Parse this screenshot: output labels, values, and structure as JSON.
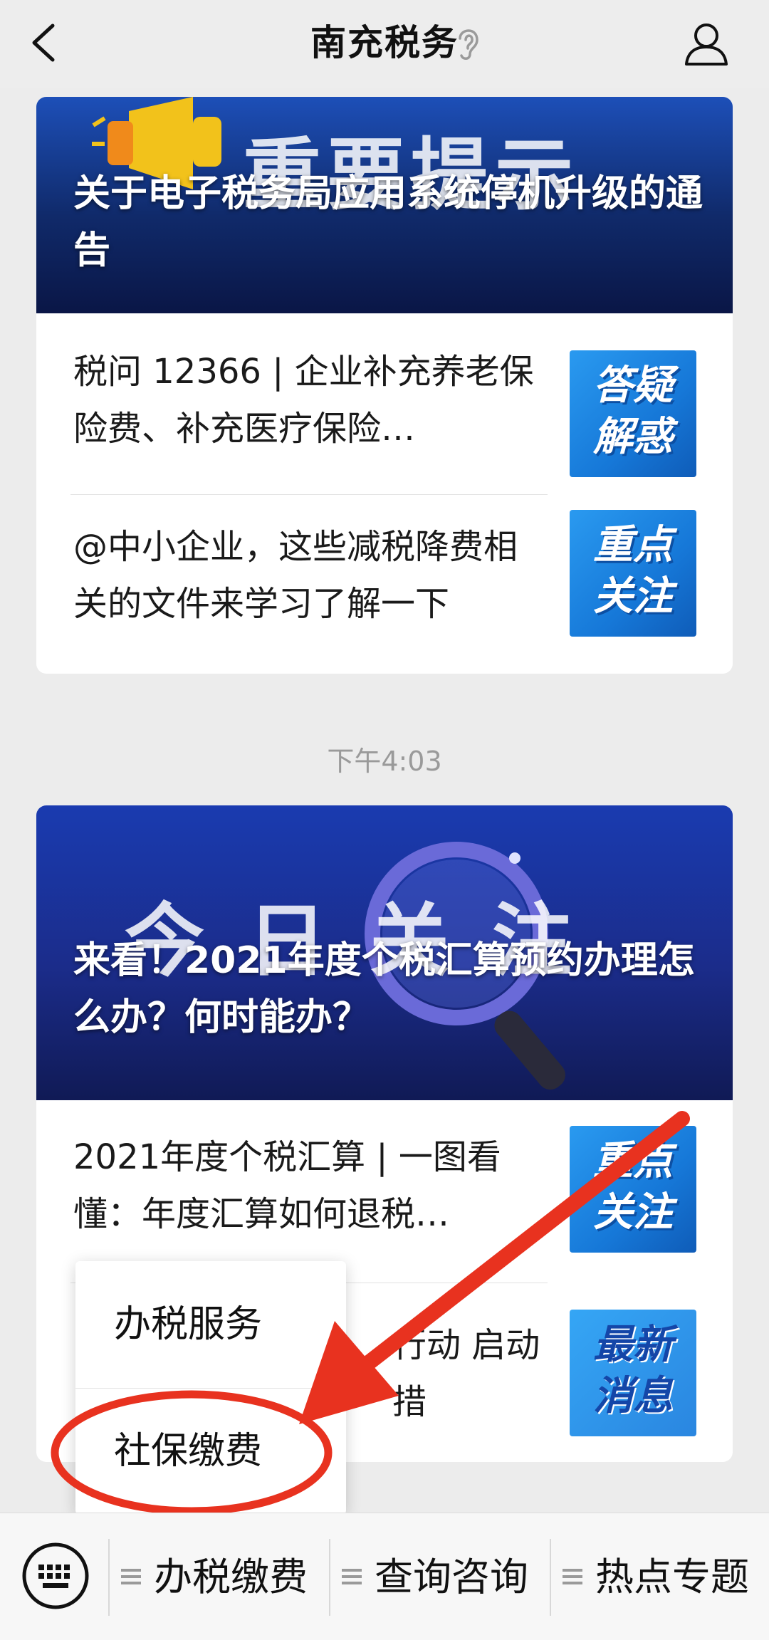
{
  "header": {
    "title": "南充税务"
  },
  "articles": [
    {
      "banner_art": "重要提示",
      "banner_title": "关于电子税务局应用系统停机升级的通告",
      "items": [
        {
          "text": "税问 12366 | 企业补充养老保险费、补充医疗保险…",
          "thumb_label": "答疑解惑"
        },
        {
          "text": "@中小企业，这些减税降费相关的文件来学习了解一下",
          "thumb_label": "重点关注"
        }
      ]
    },
    {
      "banner_art": "今日关注",
      "banner_title": "来看！2021年度个税汇算预约办理怎么办？何时能办？",
      "items": [
        {
          "text": "2021年度个税汇算 | 一图看懂：年度汇算如何退税…",
          "thumb_label": "重点关注"
        },
        {
          "text_fragment_1": "行动 启动",
          "text_fragment_2": "措",
          "thumb_label": "最新消息"
        }
      ]
    }
  ],
  "timestamp": "下午4:03",
  "popup_menu": {
    "items": [
      "办税服务",
      "社保缴费"
    ],
    "highlighted_index": 1
  },
  "bottom_menu": {
    "tabs": [
      "办税缴费",
      "查询咨询",
      "热点专题"
    ]
  },
  "colors": {
    "annotation": "#e8321f",
    "banner_blue": "#1d4fb8",
    "thumb_blue": "#1678d8"
  },
  "icons": [
    "back-arrow-icon",
    "ear-icon",
    "profile-icon",
    "keyboard-icon",
    "menu-lines-icon"
  ]
}
